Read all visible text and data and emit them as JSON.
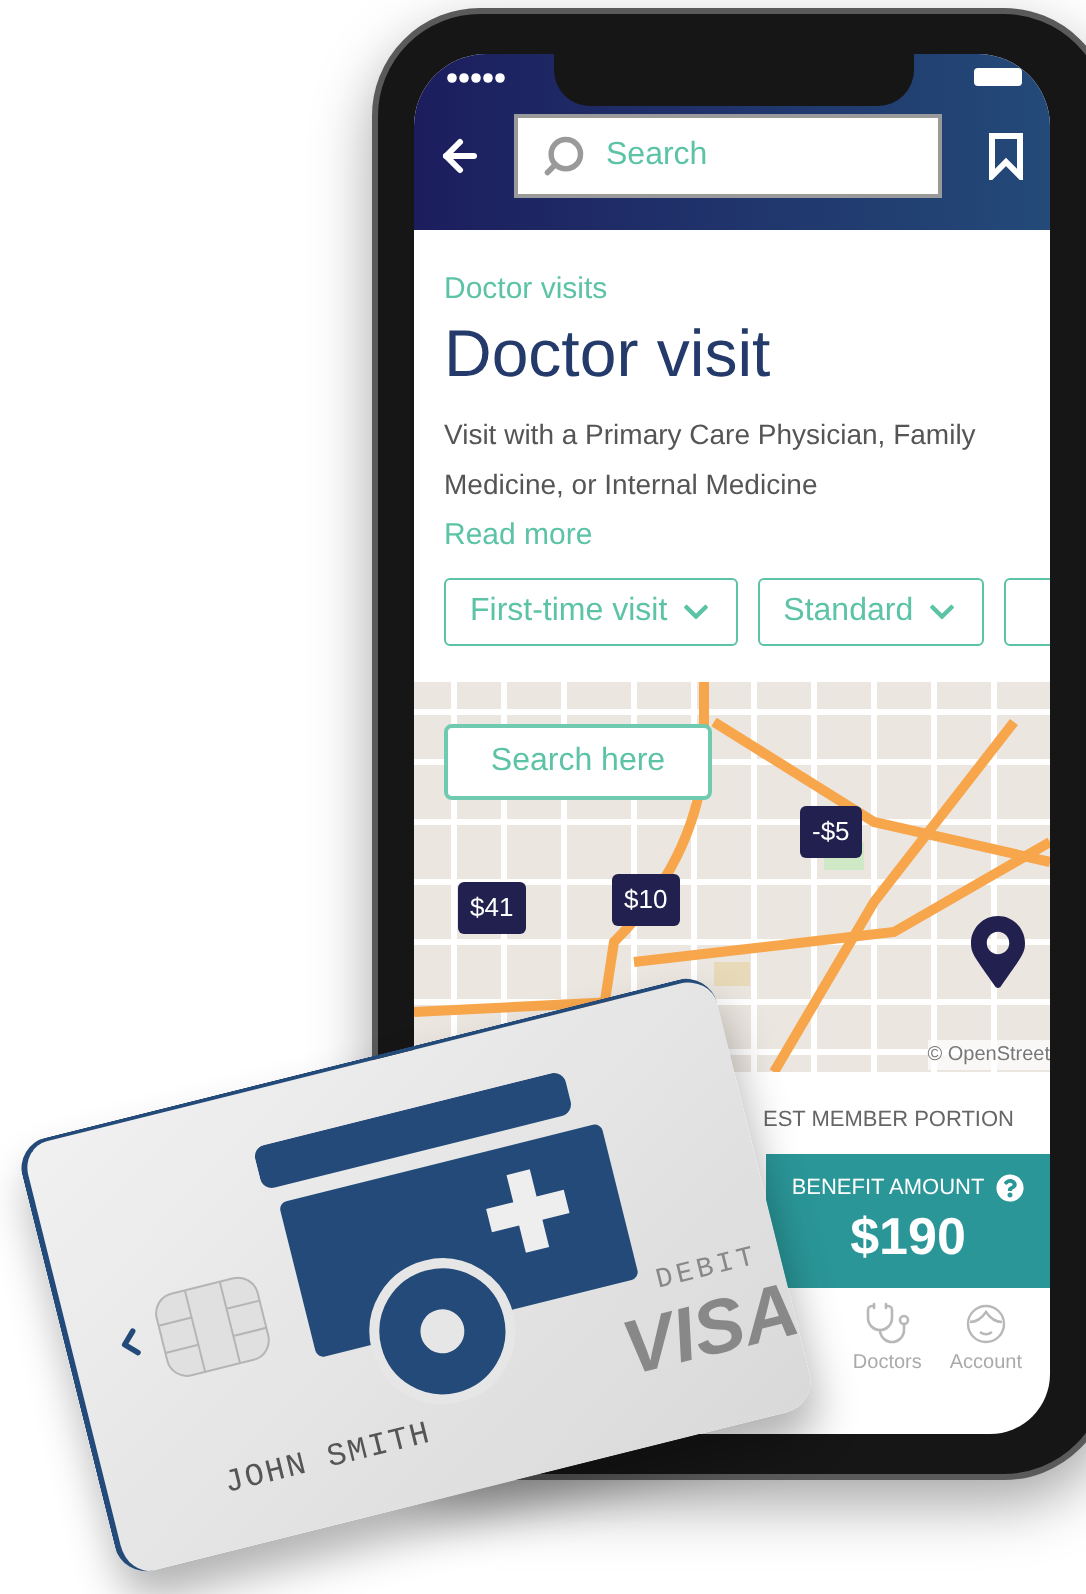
{
  "header": {
    "search": {
      "placeholder": "Search"
    }
  },
  "breadcrumb": "Doctor visits",
  "title": "Doctor visit",
  "description": "Visit with a Primary Care Physician, Family Medicine, or Internal Medicine",
  "read_more": "Read more",
  "filters": [
    {
      "label": "First-time visit"
    },
    {
      "label": "Standard"
    }
  ],
  "map": {
    "search_button": "Search here",
    "price_pins": [
      {
        "label": "-$5"
      },
      {
        "label": "$41"
      },
      {
        "label": "$10"
      }
    ],
    "attribution": "© OpenStreet"
  },
  "summary": {
    "label": "EST MEMBER PORTION",
    "benefit_label": "BENEFIT AMOUNT",
    "benefit_amount": "$190"
  },
  "bottom_nav": [
    {
      "label": "Doctors",
      "kind": "doctors"
    },
    {
      "label": "Account",
      "kind": "account"
    }
  ],
  "card": {
    "type": "DEBIT",
    "brand": "VISA",
    "holder": "JOHN SMITH"
  }
}
